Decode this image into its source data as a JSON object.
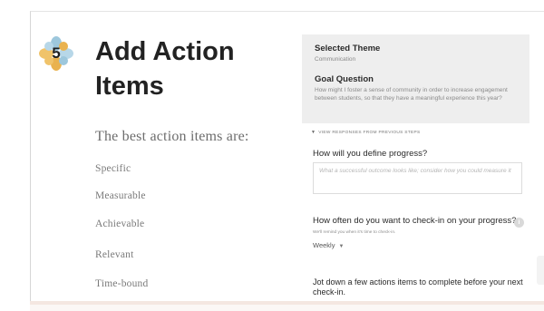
{
  "step": {
    "number": "5",
    "title": "Add Action Items",
    "colors": {
      "petal_a": "#9dc7dc",
      "petal_b": "#f0c36a",
      "petal_c": "#b7d7e8",
      "petal_d": "#e9b24f"
    }
  },
  "criteria": {
    "heading": "The best action items are:",
    "items": [
      "Specific",
      "Measurable",
      "Achievable",
      "Relevant",
      "Time-bound"
    ]
  },
  "context": {
    "theme_label": "Selected Theme",
    "theme_value": "Communication",
    "goal_label": "Goal Question",
    "goal_value": "How might I foster a sense of community in order to increase engagement between students, so that they have a meaningful experience this year?"
  },
  "previous_toggle": {
    "label": "View responses from previous steps",
    "icon": "caret-down-icon"
  },
  "progress": {
    "question": "How will you define progress?",
    "placeholder": "What a successful outcome looks like; consider how you could measure it"
  },
  "checkin": {
    "question": "How often do you want to check-in on your progress?",
    "info_icon": "info-icon",
    "info_glyph": "i",
    "helper": "We'll remind you when it's time to check-in.",
    "frequency": "Weekly",
    "dropdown_icon": "chevron-down-icon"
  },
  "actions": {
    "prompt": "Jot down a few actions items to complete before your next check-in."
  }
}
